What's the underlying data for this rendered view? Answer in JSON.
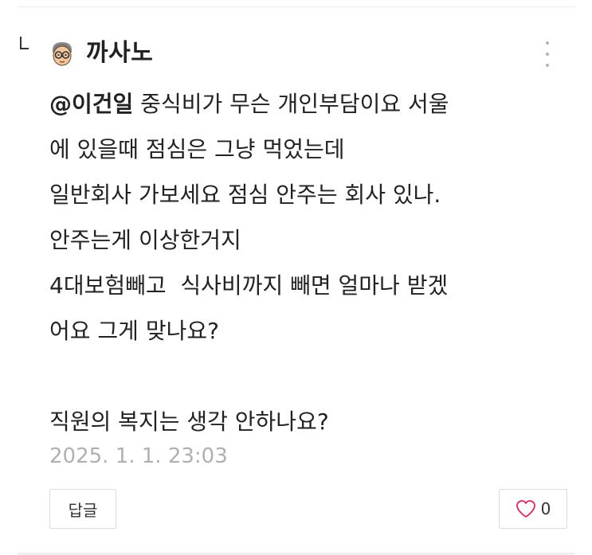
{
  "comment": {
    "author": "까사노",
    "mention": "@이건일",
    "lines": [
      " 중식비가 무슨 개인부담이요 서울",
      "에 있을때 점심은 그냥 먹었는데",
      "일반회사 가보세요 점심 안주는 회사 있나.",
      "안주는게 이상한거지",
      "4대보험빼고  식사비까지 빼면 얼마나 받겠",
      "어요 그게 맞나요?",
      "",
      "직원의 복지는 생각 안하나요?"
    ],
    "date": "2025. 1. 1. 23:03",
    "reply_label": "답글",
    "like_count": "0"
  },
  "icons": {
    "reply_arrow": "reply-arrow-icon",
    "avatar": "avatar-icon",
    "more": "more-vertical-icon",
    "heart": "heart-icon"
  },
  "colors": {
    "text": "#222222",
    "date": "#b0b0b0",
    "heart": "#e0245e",
    "border": "#dcdcdc"
  }
}
